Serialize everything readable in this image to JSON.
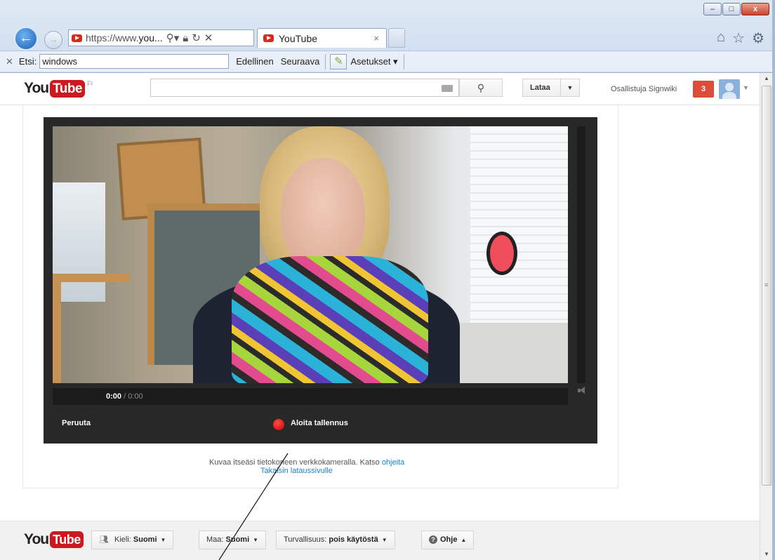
{
  "browser": {
    "url_prefix": "https://www.",
    "url_rest": "you...",
    "tab_title": "YouTube",
    "tab_close": "×",
    "window_buttons": {
      "minimize": "–",
      "maximize": "□",
      "close": "x"
    },
    "icons": [
      "home-icon",
      "star-icon",
      "gear-icon"
    ]
  },
  "findbar": {
    "close": "✕",
    "label": "Etsi:",
    "query": "windows",
    "prev": "Edellinen",
    "next": "Seuraava",
    "settings": "Asetukset ▾"
  },
  "header": {
    "logo_you": "You",
    "logo_tube": "Tube",
    "country": "FI",
    "search_placeholder": "",
    "upload_label": "Lataa",
    "username": "Osallistuja Signwiki",
    "notification_count": "3"
  },
  "player": {
    "time_current": "0:00",
    "time_sep": " / ",
    "time_duration": "0:00",
    "cancel_label": "Peruuta",
    "record_label": "Aloita tallennus",
    "colors": {
      "record": "#cc0000",
      "background": "#282828"
    }
  },
  "hint": {
    "text": "Kuvaa itseäsi tietokoneen verkkokameralla. Katso ",
    "link": "ohjeita",
    "back_link": "Takaisin lataussivulle"
  },
  "footer": {
    "language_label": "Kieli: ",
    "language_value": "Suomi",
    "country_label": "Maa: ",
    "country_value": "Suomi",
    "safety_label": "Turvallisuus: ",
    "safety_value": "pois käytöstä",
    "help_label": "Ohje"
  },
  "colors": {
    "brand_red": "#cc181e",
    "link": "#1b7fcc",
    "notification": "#dd4b39"
  }
}
